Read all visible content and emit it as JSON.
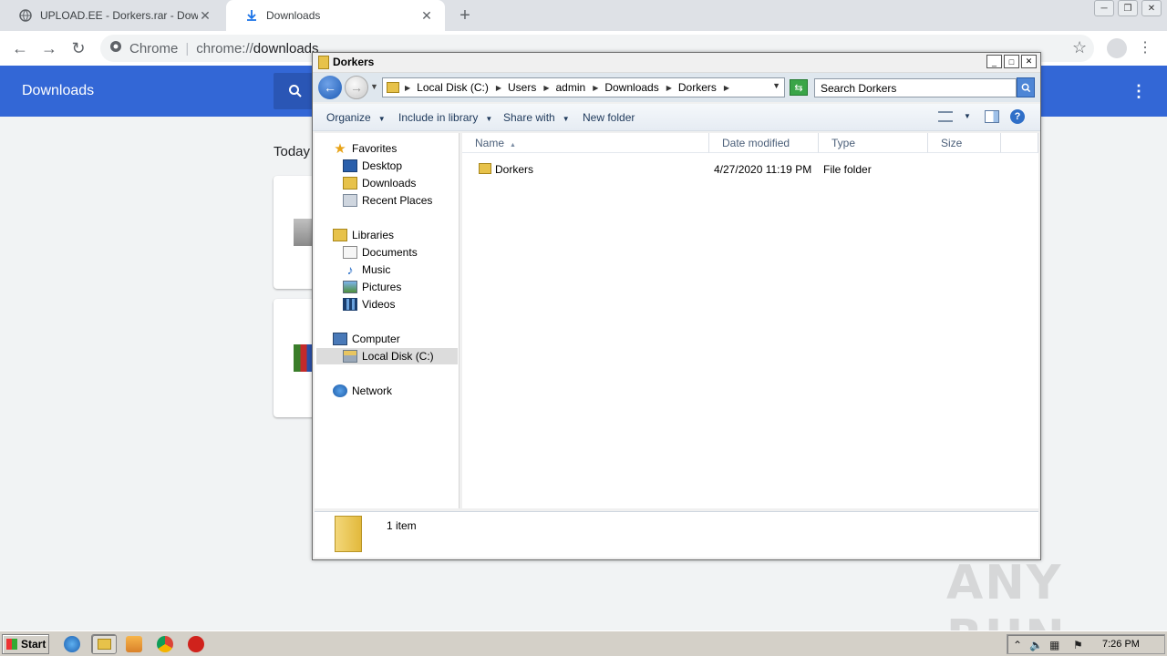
{
  "chrome": {
    "tabs": [
      {
        "title": "UPLOAD.EE - Dorkers.rar - Download",
        "active": false
      },
      {
        "title": "Downloads",
        "active": true
      }
    ],
    "new_tab": "+",
    "omnibox": {
      "site_chip": "Chrome",
      "url_scheme": "chrome://",
      "url_host": "downloads"
    },
    "page_title": "Downloads",
    "section_label": "Today"
  },
  "explorer": {
    "title": "Dorkers",
    "breadcrumbs": [
      "Local Disk (C:)",
      "Users",
      "admin",
      "Downloads",
      "Dorkers"
    ],
    "search_placeholder": "Search Dorkers",
    "commands": {
      "organize": "Organize",
      "include_in_library": "Include in library",
      "share_with": "Share with",
      "new_folder": "New folder"
    },
    "nav_pane": {
      "favorites": "Favorites",
      "desktop": "Desktop",
      "downloads": "Downloads",
      "recent_places": "Recent Places",
      "libraries": "Libraries",
      "documents": "Documents",
      "music": "Music",
      "pictures": "Pictures",
      "videos": "Videos",
      "computer": "Computer",
      "local_disk": "Local Disk (C:)",
      "network": "Network"
    },
    "columns": {
      "name": "Name",
      "date_modified": "Date modified",
      "type": "Type",
      "size": "Size"
    },
    "files": [
      {
        "name": "Dorkers",
        "date_modified": "4/27/2020 11:19 PM",
        "type": "File folder",
        "size": ""
      }
    ],
    "details": {
      "item_count": "1 item"
    }
  },
  "taskbar": {
    "start_label": "Start",
    "clock": "7:26 PM"
  },
  "watermark": "ANY RUN"
}
